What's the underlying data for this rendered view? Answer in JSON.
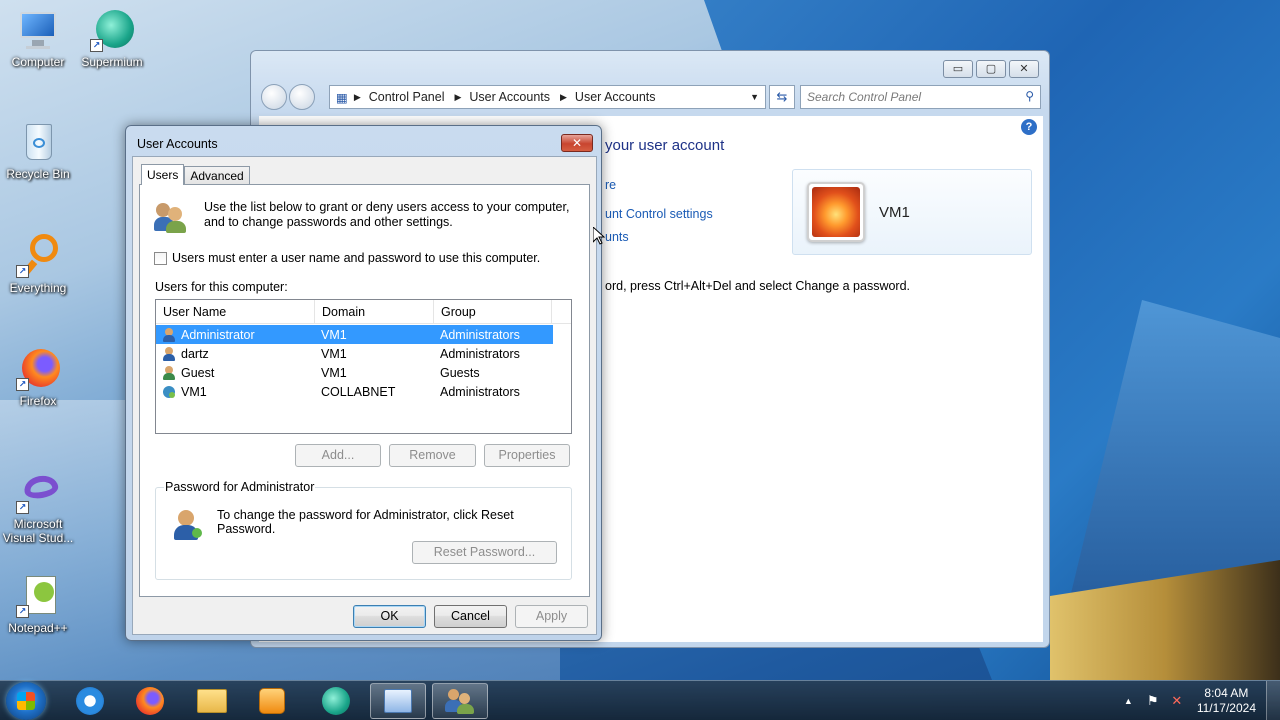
{
  "desktop": {
    "icons": [
      {
        "label": "Computer",
        "icon": "computer-icon"
      },
      {
        "label": "Supermium",
        "icon": "supermium-icon"
      },
      {
        "label": "Recycle Bin",
        "icon": "recycle-bin-icon"
      },
      {
        "label": "Everything",
        "icon": "everything-search-icon"
      },
      {
        "label": "Firefox",
        "icon": "firefox-icon"
      },
      {
        "label": "Microsoft Visual Stud...",
        "icon": "visual-studio-icon"
      },
      {
        "label": "Notepad++",
        "icon": "notepadpp-icon"
      }
    ]
  },
  "explorer": {
    "breadcrumb": [
      "Control Panel",
      "User Accounts",
      "User Accounts"
    ],
    "search_placeholder": "Search Control Panel",
    "heading_fragment": "your user account",
    "links": [
      "re",
      "unt Control settings",
      "unts"
    ],
    "note_fragment": "ord, press Ctrl+Alt+Del and select Change a password.",
    "user_card": {
      "name": "VM1"
    }
  },
  "dialog": {
    "title": "User Accounts",
    "tabs": [
      "Users",
      "Advanced"
    ],
    "intro": "Use the list below to grant or deny users access to your computer, and to change passwords and other settings.",
    "checkbox_label": "Users must enter a user name and password to use this computer.",
    "checkbox_checked": false,
    "users_label": "Users for this computer:",
    "columns": [
      "User Name",
      "Domain",
      "Group"
    ],
    "users": [
      {
        "name": "Administrator",
        "domain": "VM1",
        "group": "Administrators",
        "selected": true
      },
      {
        "name": "dartz",
        "domain": "VM1",
        "group": "Administrators",
        "selected": false
      },
      {
        "name": "Guest",
        "domain": "VM1",
        "group": "Guests",
        "selected": false
      },
      {
        "name": "VM1",
        "domain": "COLLABNET",
        "group": "Administrators",
        "selected": false
      }
    ],
    "buttons": {
      "add": "Add...",
      "remove": "Remove",
      "properties": "Properties"
    },
    "password_group": {
      "legend": "Password for Administrator",
      "text": "To change the password for Administrator, click Reset Password.",
      "reset": "Reset Password..."
    },
    "footer": {
      "ok": "OK",
      "cancel": "Cancel",
      "apply": "Apply"
    }
  },
  "taskbar": {
    "items": [
      "internet-explorer-icon",
      "firefox-icon",
      "file-explorer-icon",
      "media-player-icon",
      "supermium-icon",
      "control-panel-icon",
      "user-accounts-icon"
    ],
    "clock_time": "8:04 AM",
    "clock_date": "11/17/2024"
  }
}
